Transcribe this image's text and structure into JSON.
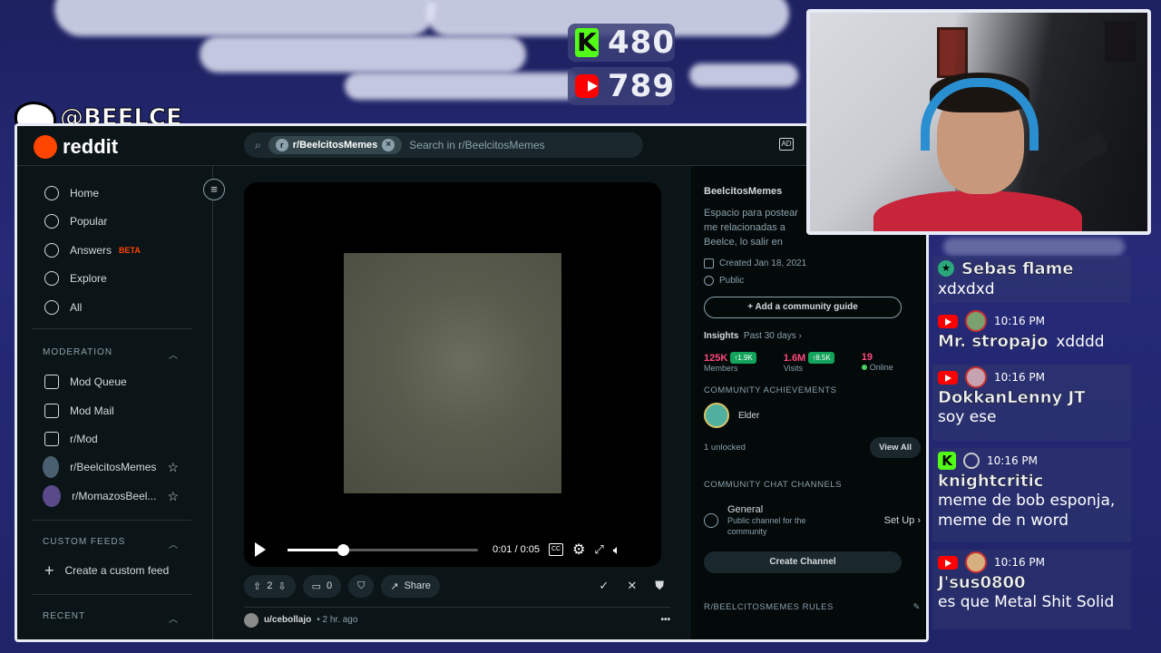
{
  "overlay": {
    "kick_count": "480",
    "youtube_count": "789",
    "twitter_handle": "@BEELCE_"
  },
  "topbar": {
    "logo_text": "reddit",
    "search_chip": "r/BeelcitosMemes",
    "search_placeholder": "Search in r/BeelcitosMemes"
  },
  "sidebar": {
    "nav": [
      {
        "label": "Home",
        "icon": "home-icon"
      },
      {
        "label": "Popular",
        "icon": "popular-icon"
      },
      {
        "label": "Answers",
        "badge": "BETA",
        "icon": "answers-icon"
      },
      {
        "label": "Explore",
        "icon": "explore-icon"
      },
      {
        "label": "All",
        "icon": "all-icon"
      }
    ],
    "moderation_label": "MODERATION",
    "moderation": [
      {
        "label": "Mod Queue"
      },
      {
        "label": "Mod Mail"
      },
      {
        "label": "r/Mod"
      },
      {
        "label": "r/BeelcitosMemes"
      },
      {
        "label": "r/MomazosBeel..."
      }
    ],
    "custom_feeds_label": "CUSTOM FEEDS",
    "create_feed_label": "Create a custom feed",
    "recent_label": "RECENT"
  },
  "video": {
    "time": "0:01 / 0:05",
    "progress": 0.29
  },
  "post_actions": {
    "votes": "2",
    "comments": "0",
    "share": "Share"
  },
  "post_meta": {
    "user": "u/cebollajo",
    "time": "• 2 hr. ago"
  },
  "community": {
    "name": "BeelcitosMemes",
    "description": "Espacio para postear me relacionadas a Beelce, lo salir en Stream!",
    "created": "Created Jan 18, 2021",
    "visibility": "Public",
    "guide_button": "Add a community guide",
    "insights_label": "Insights",
    "insights_period": "Past 30 days",
    "members": "125K",
    "members_delta": "1.9K",
    "members_label": "Members",
    "visits": "1.6M",
    "visits_delta": "8.5K",
    "visits_label": "Visits",
    "online": "19",
    "online_label": "Online",
    "achievements_label": "COMMUNITY ACHIEVEMENTS",
    "achievement": "Elder",
    "unlocked": "1 unlocked",
    "view_all": "View All",
    "chat_label": "COMMUNITY CHAT CHANNELS",
    "channel_name": "General",
    "channel_desc": "Public channel for the community",
    "setup": "Set Up",
    "create_channel": "Create Channel",
    "rules_label": "R/BEELCITOSMEMES RULES"
  },
  "chat": [
    {
      "platform": "kick",
      "name": "Sebas flame",
      "text": "xdxdxd",
      "time": ""
    },
    {
      "platform": "youtube",
      "name": "Mr. stropajo",
      "text": "xdddd",
      "time": "10:16 PM"
    },
    {
      "platform": "youtube",
      "name": "DokkanLenny JT",
      "text": "soy ese",
      "time": "10:16 PM"
    },
    {
      "platform": "kick",
      "name": "knightcritic",
      "text": "meme de bob esponja, meme de n word",
      "time": "10:16 PM"
    },
    {
      "platform": "youtube",
      "name": "J'sus0800",
      "text": "es que Metal Shit Solid",
      "time": "10:16 PM"
    }
  ]
}
